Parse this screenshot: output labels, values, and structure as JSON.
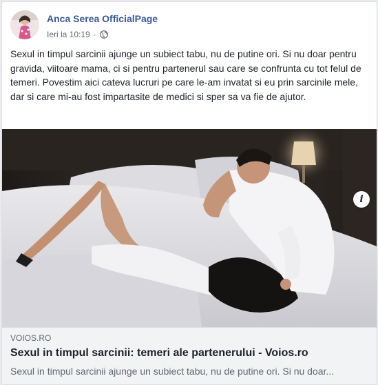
{
  "post": {
    "author": "Anca Serea OfficialPage",
    "timestamp": "Ieri la 10:19",
    "separator": "·",
    "privacy_icon": "globe-icon",
    "text": "Sexul in timpul sarcinii ajunge un subiect tabu, nu de putine ori. Si nu doar pentru gravida, viitoare mama, ci si pentru partenerul sau care se confrunta cu tot felul de temeri. Povestim aici cateva lucruri pe care le-am invatat si eu prin sarcinile mele, dar si care mi-au fost impartasite de medici si sper sa va fie de ajutor."
  },
  "link_preview": {
    "domain": "VOIOS.RO",
    "title": "Sexul in timpul sarcinii: temeri ale partenerului - Voios.ro",
    "description": "Sexul in timpul sarcinii ajunge un subiect tabu, nu de putine ori. Si nu doar...",
    "info_label": "i"
  },
  "colors": {
    "author_link": "#385898",
    "text": "#1d2129",
    "secondary_text": "#606770",
    "link_box_bg": "#f2f3f5"
  }
}
